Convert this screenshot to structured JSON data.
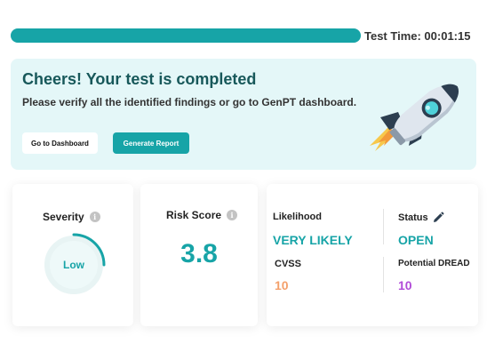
{
  "progress": {
    "fraction": 1.0,
    "test_time": "Test Time: 00:01:15"
  },
  "banner": {
    "title": "Cheers! Your test is completed",
    "subtitle": "Please verify all the identified findings or go to GenPT dashboard.",
    "dashboard_button": "Go to Dashboard",
    "report_button": "Generate Report",
    "illustration": "rocket-icon"
  },
  "severity": {
    "title": "Severity",
    "level": "Low",
    "gauge_fraction": 0.25
  },
  "risk": {
    "title": "Risk Score",
    "value": "3.8"
  },
  "details": {
    "likelihood_label": "Likelihood",
    "likelihood_value": "VERY LIKELY",
    "status_label": "Status",
    "status_value": "OPEN",
    "cvss_label": "CVSS",
    "cvss_value": "10",
    "dread_label": "Potential DREAD",
    "dread_value": "10"
  },
  "colors": {
    "accent": "#17a4a7",
    "cvss": "#f4a06b",
    "dread": "#b14bd8",
    "banner_bg": "#e4f7f8"
  }
}
